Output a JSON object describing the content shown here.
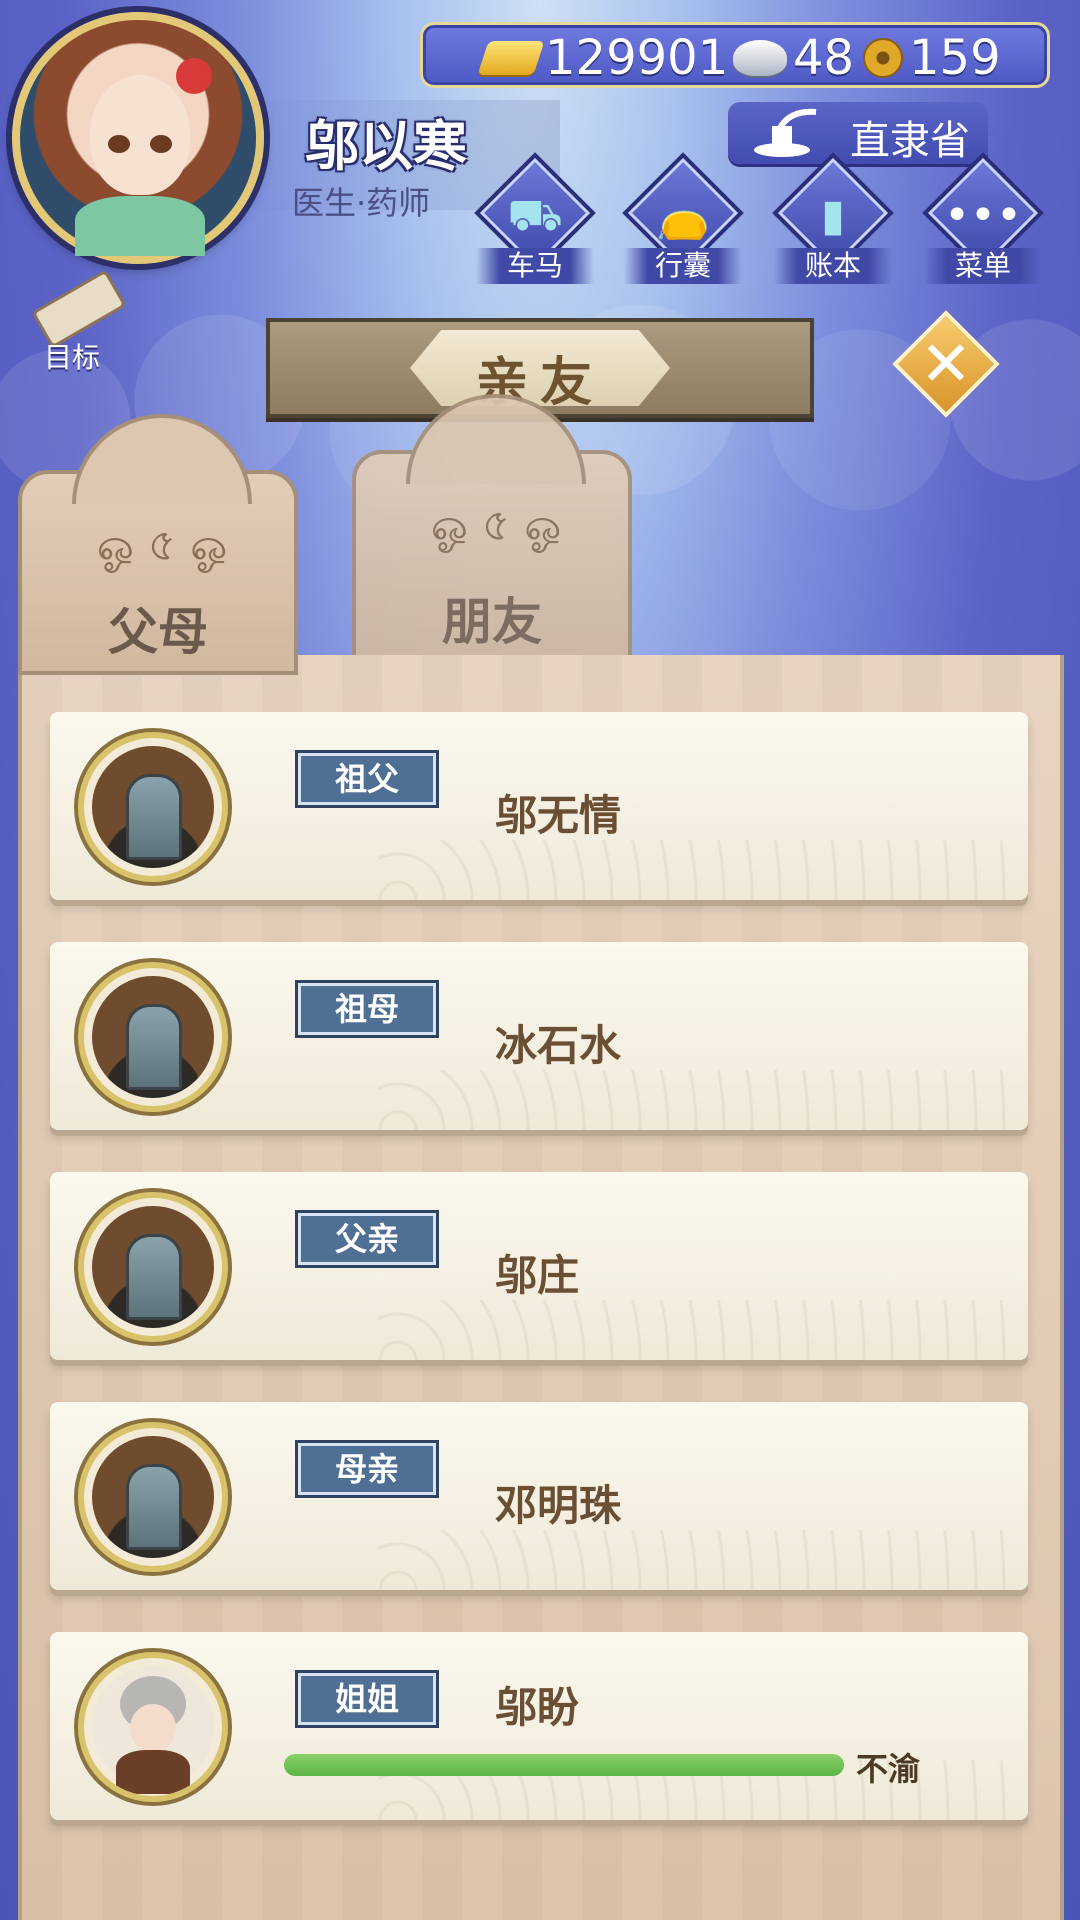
{
  "player": {
    "name": "邬以寒",
    "profession": "医生·药师",
    "location": "直隶省"
  },
  "currency": {
    "gold": "129901",
    "silver": "48",
    "coins": "159"
  },
  "menu": [
    {
      "label": "车马",
      "icon": "carriage-icon"
    },
    {
      "label": "行囊",
      "icon": "bag-icon"
    },
    {
      "label": "账本",
      "icon": "ledger-icon"
    },
    {
      "label": "菜单",
      "icon": "more-icon"
    }
  ],
  "goal_label": "目标",
  "page_title": "亲友",
  "tabs": [
    {
      "label": "父母",
      "active": true
    },
    {
      "label": "朋友",
      "active": false
    }
  ],
  "relatives": [
    {
      "relation": "祖父",
      "name": "邬无情",
      "deceased": true
    },
    {
      "relation": "祖母",
      "name": "冰石水",
      "deceased": true
    },
    {
      "relation": "父亲",
      "name": "邬庄",
      "deceased": true
    },
    {
      "relation": "母亲",
      "name": "邓明珠",
      "deceased": true
    },
    {
      "relation": "姐姐",
      "name": "邬盼",
      "deceased": false,
      "favor_fraction": 1.0,
      "mood": "不渝"
    }
  ],
  "colors": {
    "badge": "#4f6f95",
    "favor_bar": "#5bb443",
    "accent_gold": "#e4a91d"
  }
}
